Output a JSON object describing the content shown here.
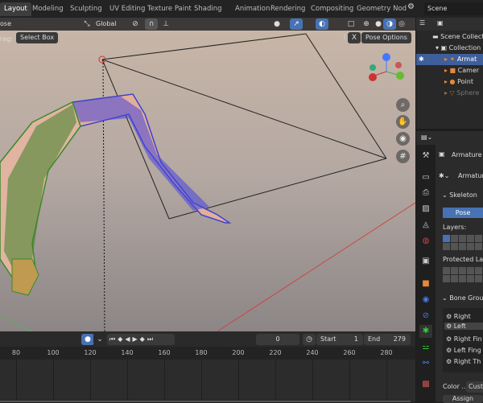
{
  "topbar": {
    "tabs": [
      "Layout",
      "Modeling",
      "Sculpting",
      "UV Editing",
      "Texture Paint",
      "Shading",
      "Animation",
      "Rendering",
      "Compositing",
      "Geometry Nod"
    ],
    "scene": "Scene"
  },
  "viewport": {
    "mode": "ose",
    "transform_orientation": "Global",
    "drag_label": "rag:",
    "drag_value": "Select Box",
    "x_label": "X",
    "pose_options": "Pose Options"
  },
  "outliner": {
    "items": [
      "Scene Collecti",
      "Collection",
      "Armat",
      "Camer",
      "Point",
      "Sphere"
    ]
  },
  "properties": {
    "object": "Armature",
    "data": "Armatur",
    "skeleton": "Skeleton",
    "pose_btn": "Pose",
    "layers": "Layers:",
    "protected": "Protected Laye",
    "bone_groups": "Bone Group",
    "groups": [
      "Right",
      "Left",
      "Right Fin",
      "Left Fing",
      "Right Th"
    ],
    "color_label": "Color ...",
    "color_value": "Custo",
    "assign": "Assign"
  },
  "timeline": {
    "current": "0",
    "start_label": "Start",
    "start": "1",
    "end_label": "End",
    "end": "279",
    "ticks": [
      "80",
      "100",
      "120",
      "140",
      "160",
      "180",
      "200",
      "220",
      "240",
      "260",
      "280"
    ]
  },
  "colors": {
    "accent": "#4772b3",
    "bone_blue": "#3a3ae0",
    "bone_green": "#3a8a2a"
  }
}
